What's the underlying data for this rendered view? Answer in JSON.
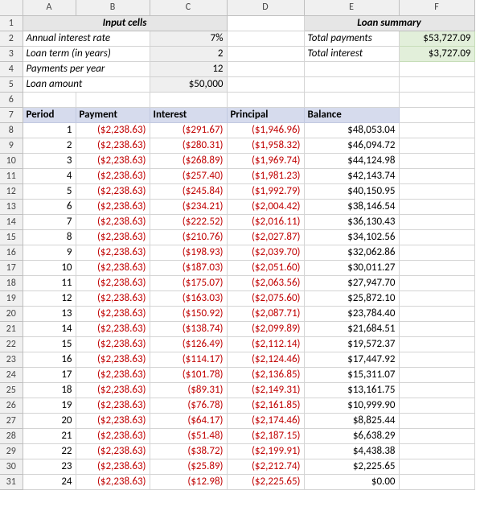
{
  "columns": [
    "A",
    "B",
    "C",
    "D",
    "E",
    "F"
  ],
  "row_numbers": [
    1,
    2,
    3,
    4,
    5,
    6,
    7,
    8,
    9,
    10,
    11,
    12,
    13,
    14,
    15,
    16,
    17,
    18,
    19,
    20,
    21,
    22,
    23,
    24,
    25,
    26,
    27,
    28,
    29,
    30,
    31
  ],
  "input_header": "Input cells",
  "summary_header": "Loan summary",
  "inputs": {
    "rate_label": "Annual interest rate",
    "rate_value": "7%",
    "term_label": "Loan term (in years)",
    "term_value": "2",
    "ppy_label": "Payments per year",
    "ppy_value": "12",
    "amount_label": "Loan amount",
    "amount_value": "$50,000"
  },
  "summary": {
    "tp_label": "Total payments",
    "tp_value": "$53,727.09",
    "ti_label": "Total interest",
    "ti_value": "$3,727.09"
  },
  "table_headers": {
    "period": "Period",
    "payment": "Payment",
    "interest": "Interest",
    "principal": "Principal",
    "balance": "Balance"
  },
  "rows": [
    {
      "period": "1",
      "payment": "($2,238.63)",
      "interest": "($291.67)",
      "principal": "($1,946.96)",
      "balance": "$48,053.04"
    },
    {
      "period": "2",
      "payment": "($2,238.63)",
      "interest": "($280.31)",
      "principal": "($1,958.32)",
      "balance": "$46,094.72"
    },
    {
      "period": "3",
      "payment": "($2,238.63)",
      "interest": "($268.89)",
      "principal": "($1,969.74)",
      "balance": "$44,124.98"
    },
    {
      "period": "4",
      "payment": "($2,238.63)",
      "interest": "($257.40)",
      "principal": "($1,981.23)",
      "balance": "$42,143.74"
    },
    {
      "period": "5",
      "payment": "($2,238.63)",
      "interest": "($245.84)",
      "principal": "($1,992.79)",
      "balance": "$40,150.95"
    },
    {
      "period": "6",
      "payment": "($2,238.63)",
      "interest": "($234.21)",
      "principal": "($2,004.42)",
      "balance": "$38,146.54"
    },
    {
      "period": "7",
      "payment": "($2,238.63)",
      "interest": "($222.52)",
      "principal": "($2,016.11)",
      "balance": "$36,130.43"
    },
    {
      "period": "8",
      "payment": "($2,238.63)",
      "interest": "($210.76)",
      "principal": "($2,027.87)",
      "balance": "$34,102.56"
    },
    {
      "period": "9",
      "payment": "($2,238.63)",
      "interest": "($198.93)",
      "principal": "($2,039.70)",
      "balance": "$32,062.86"
    },
    {
      "period": "10",
      "payment": "($2,238.63)",
      "interest": "($187.03)",
      "principal": "($2,051.60)",
      "balance": "$30,011.27"
    },
    {
      "period": "11",
      "payment": "($2,238.63)",
      "interest": "($175.07)",
      "principal": "($2,063.56)",
      "balance": "$27,947.70"
    },
    {
      "period": "12",
      "payment": "($2,238.63)",
      "interest": "($163.03)",
      "principal": "($2,075.60)",
      "balance": "$25,872.10"
    },
    {
      "period": "13",
      "payment": "($2,238.63)",
      "interest": "($150.92)",
      "principal": "($2,087.71)",
      "balance": "$23,784.40"
    },
    {
      "period": "14",
      "payment": "($2,238.63)",
      "interest": "($138.74)",
      "principal": "($2,099.89)",
      "balance": "$21,684.51"
    },
    {
      "period": "15",
      "payment": "($2,238.63)",
      "interest": "($126.49)",
      "principal": "($2,112.14)",
      "balance": "$19,572.37"
    },
    {
      "period": "16",
      "payment": "($2,238.63)",
      "interest": "($114.17)",
      "principal": "($2,124.46)",
      "balance": "$17,447.92"
    },
    {
      "period": "17",
      "payment": "($2,238.63)",
      "interest": "($101.78)",
      "principal": "($2,136.85)",
      "balance": "$15,311.07"
    },
    {
      "period": "18",
      "payment": "($2,238.63)",
      "interest": "($89.31)",
      "principal": "($2,149.31)",
      "balance": "$13,161.75"
    },
    {
      "period": "19",
      "payment": "($2,238.63)",
      "interest": "($76.78)",
      "principal": "($2,161.85)",
      "balance": "$10,999.90"
    },
    {
      "period": "20",
      "payment": "($2,238.63)",
      "interest": "($64.17)",
      "principal": "($2,174.46)",
      "balance": "$8,825.44"
    },
    {
      "period": "21",
      "payment": "($2,238.63)",
      "interest": "($51.48)",
      "principal": "($2,187.15)",
      "balance": "$6,638.29"
    },
    {
      "period": "22",
      "payment": "($2,238.63)",
      "interest": "($38.72)",
      "principal": "($2,199.91)",
      "balance": "$4,438.38"
    },
    {
      "period": "23",
      "payment": "($2,238.63)",
      "interest": "($25.89)",
      "principal": "($2,212.74)",
      "balance": "$2,225.65"
    },
    {
      "period": "24",
      "payment": "($2,238.63)",
      "interest": "($12.98)",
      "principal": "($2,225.65)",
      "balance": "$0.00"
    }
  ]
}
